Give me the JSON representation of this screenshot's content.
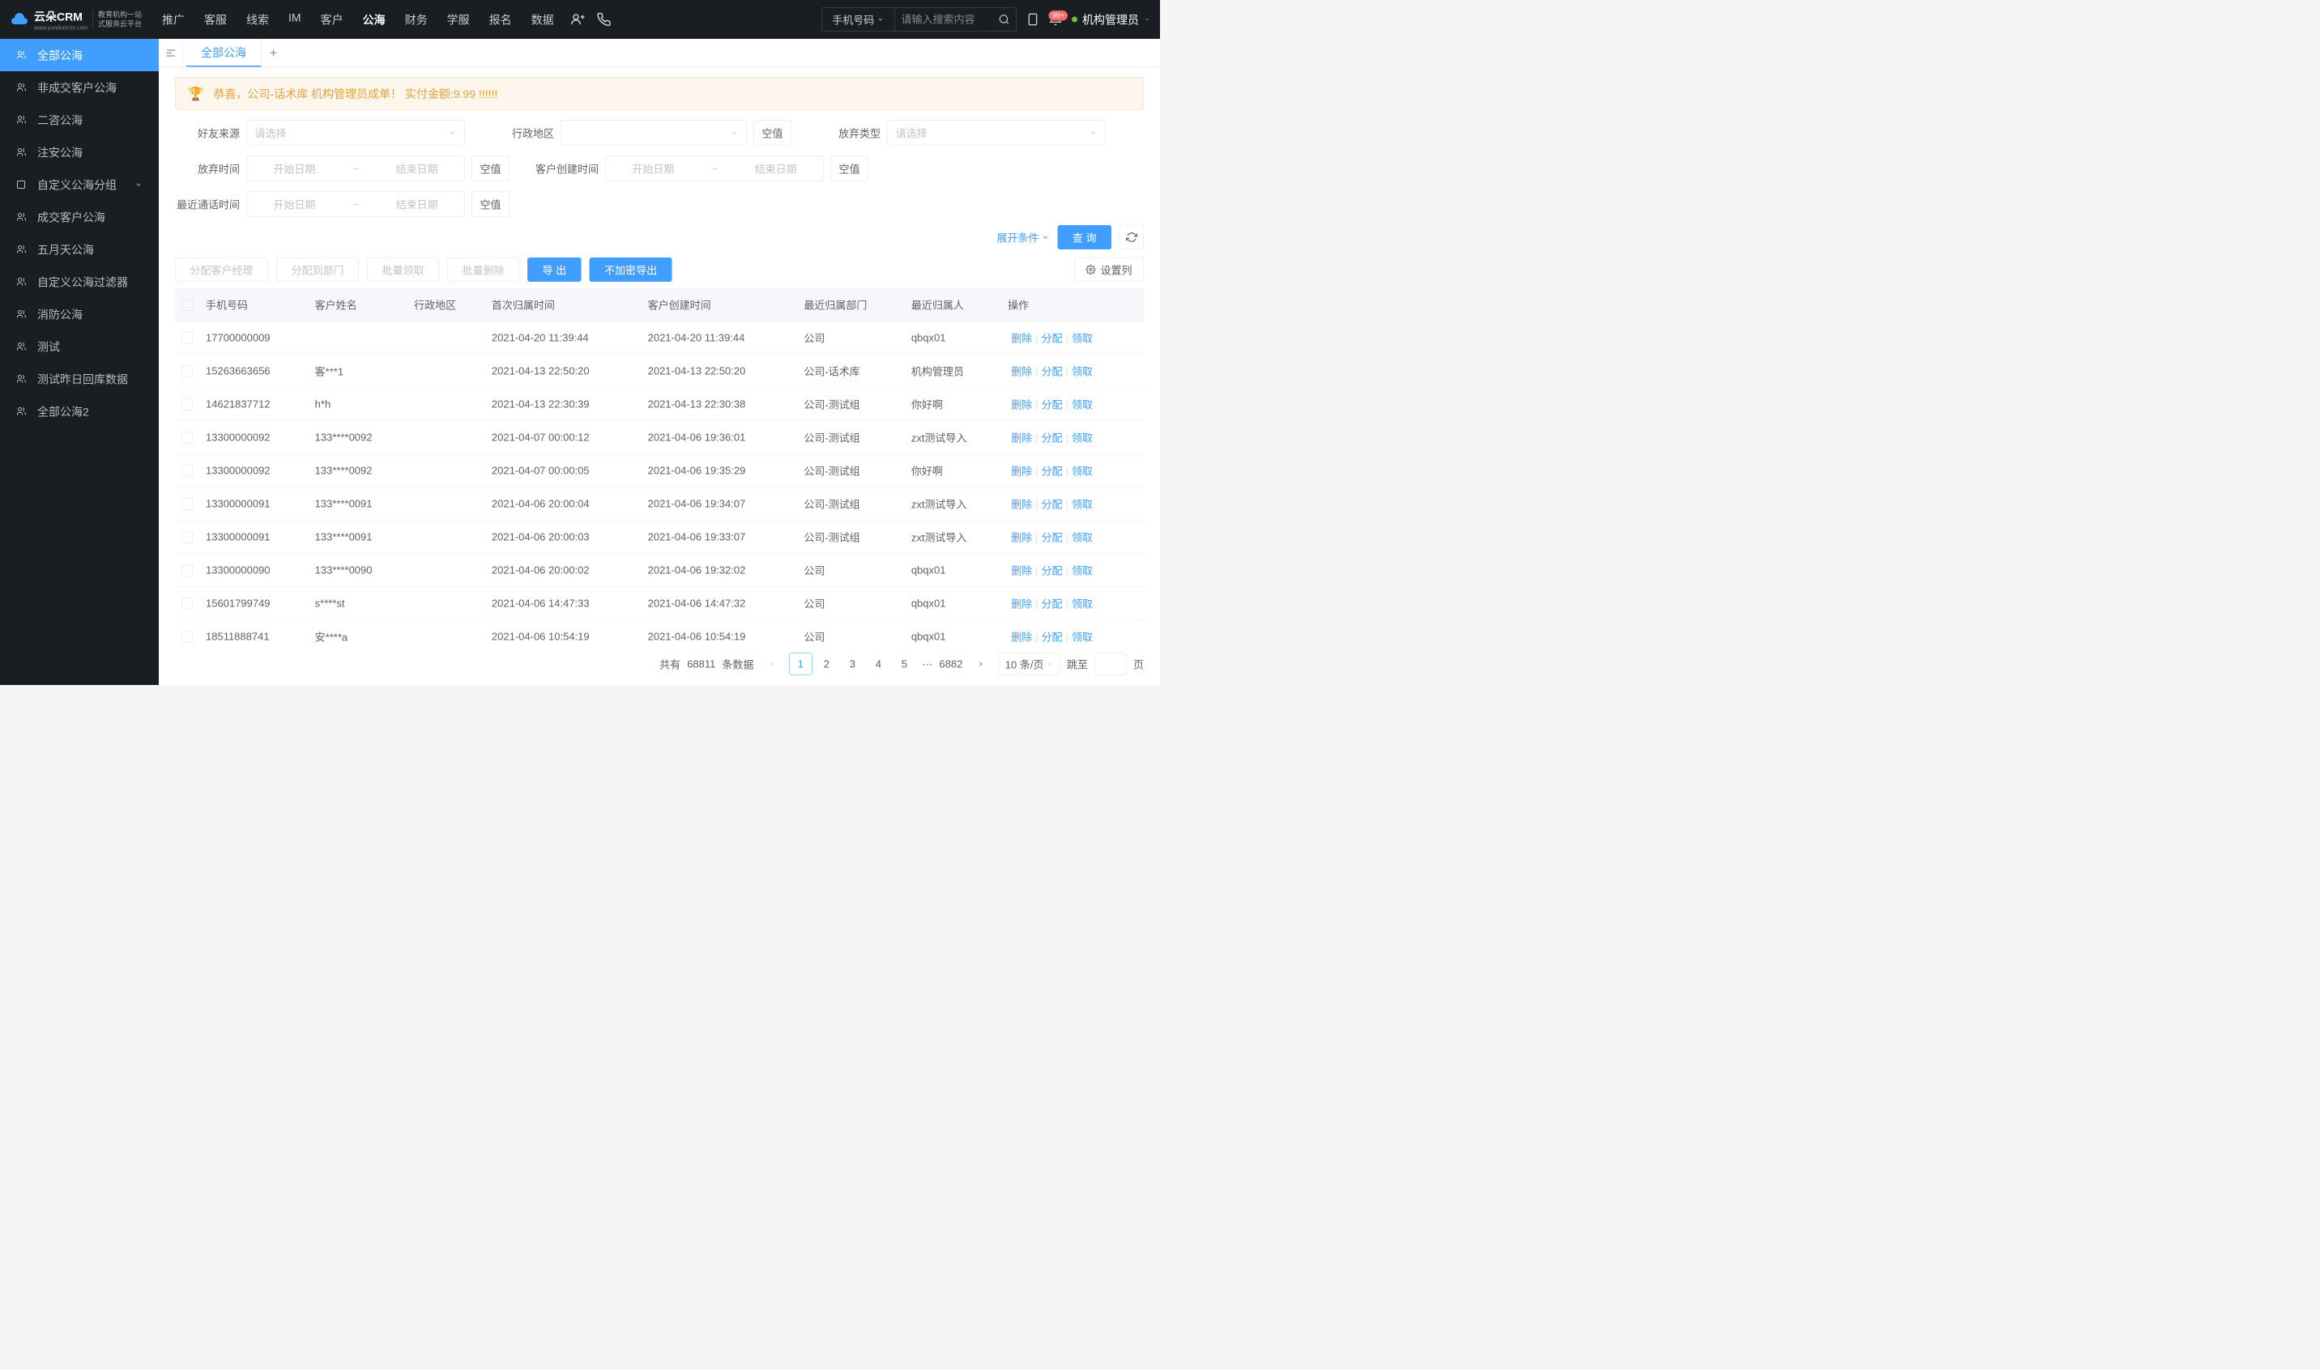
{
  "header": {
    "logo": "云朵CRM",
    "logo_url": "www.yunduocrm.com",
    "logo_sub1": "教育机构一站",
    "logo_sub2": "式服务云平台",
    "nav": [
      "推广",
      "客服",
      "线索",
      "IM",
      "客户",
      "公海",
      "财务",
      "学服",
      "报名",
      "数据"
    ],
    "nav_active": 5,
    "search_type": "手机号码",
    "search_placeholder": "请输入搜索内容",
    "badge": "99+",
    "user": "机构管理员"
  },
  "sidebar": [
    {
      "label": "全部公海",
      "active": true
    },
    {
      "label": "非成交客户公海"
    },
    {
      "label": "二咨公海"
    },
    {
      "label": "注安公海"
    },
    {
      "label": "自定义公海分组",
      "expandable": true
    },
    {
      "label": "成交客户公海"
    },
    {
      "label": "五月天公海"
    },
    {
      "label": "自定义公海过滤器"
    },
    {
      "label": "消防公海"
    },
    {
      "label": "测试"
    },
    {
      "label": "测试昨日回库数据"
    },
    {
      "label": "全部公海2"
    }
  ],
  "tabs": {
    "active": "全部公海"
  },
  "banner": "恭喜，公司-话术库  机构管理员成单！  实付金额:9.99 !!!!!!",
  "filters": {
    "friend_source": {
      "label": "好友来源",
      "placeholder": "请选择"
    },
    "region": {
      "label": "行政地区",
      "null": "空值"
    },
    "abandon_type": {
      "label": "放弃类型",
      "placeholder": "请选择"
    },
    "abandon_time": {
      "label": "放弃时间",
      "start": "开始日期",
      "end": "结束日期",
      "null": "空值"
    },
    "create_time": {
      "label": "客户创建时间",
      "start": "开始日期",
      "end": "结束日期",
      "null": "空值"
    },
    "call_time": {
      "label": "最近通话时间",
      "start": "开始日期",
      "end": "结束日期",
      "null": "空值"
    }
  },
  "filter_actions": {
    "expand": "展开条件",
    "query": "查 询"
  },
  "toolbar": {
    "assign_manager": "分配客户经理",
    "assign_dept": "分配到部门",
    "batch_claim": "批量领取",
    "batch_delete": "批量删除",
    "export": "导 出",
    "export_plain": "不加密导出",
    "settings": "设置列"
  },
  "table": {
    "columns": [
      "手机号码",
      "客户姓名",
      "行政地区",
      "首次归属时间",
      "客户创建时间",
      "最近归属部门",
      "最近归属人",
      "操作"
    ],
    "actions": {
      "delete": "删除",
      "assign": "分配",
      "claim": "领取"
    },
    "rows": [
      {
        "phone": "17700000009",
        "name": "",
        "region": "",
        "first": "2021-04-20 11:39:44",
        "created": "2021-04-20 11:39:44",
        "dept": "公司",
        "owner": "qbqx01"
      },
      {
        "phone": "15263663656",
        "name": "客***1",
        "region": "",
        "first": "2021-04-13 22:50:20",
        "created": "2021-04-13 22:50:20",
        "dept": "公司-话术库",
        "owner": "机构管理员"
      },
      {
        "phone": "14621837712",
        "name": "h*h",
        "region": "",
        "first": "2021-04-13 22:30:39",
        "created": "2021-04-13 22:30:38",
        "dept": "公司-测试组",
        "owner": "你好啊"
      },
      {
        "phone": "13300000092",
        "name": "133****0092",
        "region": "",
        "first": "2021-04-07 00:00:12",
        "created": "2021-04-06 19:36:01",
        "dept": "公司-测试组",
        "owner": "zxt测试导入"
      },
      {
        "phone": "13300000092",
        "name": "133****0092",
        "region": "",
        "first": "2021-04-07 00:00:05",
        "created": "2021-04-06 19:35:29",
        "dept": "公司-测试组",
        "owner": "你好啊"
      },
      {
        "phone": "13300000091",
        "name": "133****0091",
        "region": "",
        "first": "2021-04-06 20:00:04",
        "created": "2021-04-06 19:34:07",
        "dept": "公司-测试组",
        "owner": "zxt测试导入"
      },
      {
        "phone": "13300000091",
        "name": "133****0091",
        "region": "",
        "first": "2021-04-06 20:00:03",
        "created": "2021-04-06 19:33:07",
        "dept": "公司-测试组",
        "owner": "zxt测试导入"
      },
      {
        "phone": "13300000090",
        "name": "133****0090",
        "region": "",
        "first": "2021-04-06 20:00:02",
        "created": "2021-04-06 19:32:02",
        "dept": "公司",
        "owner": "qbqx01"
      },
      {
        "phone": "15601799749",
        "name": "s****st",
        "region": "",
        "first": "2021-04-06 14:47:33",
        "created": "2021-04-06 14:47:32",
        "dept": "公司",
        "owner": "qbqx01"
      },
      {
        "phone": "18511888741",
        "name": "安****a",
        "region": "",
        "first": "2021-04-06 10:54:19",
        "created": "2021-04-06 10:54:19",
        "dept": "公司",
        "owner": "qbqx01"
      }
    ]
  },
  "pagination": {
    "total_prefix": "共有",
    "total": "68811",
    "total_suffix": "条数据",
    "pages": [
      "1",
      "2",
      "3",
      "4",
      "5"
    ],
    "last": "6882",
    "per_page": "10 条/页",
    "jump": "跳至",
    "page_suffix": "页"
  }
}
